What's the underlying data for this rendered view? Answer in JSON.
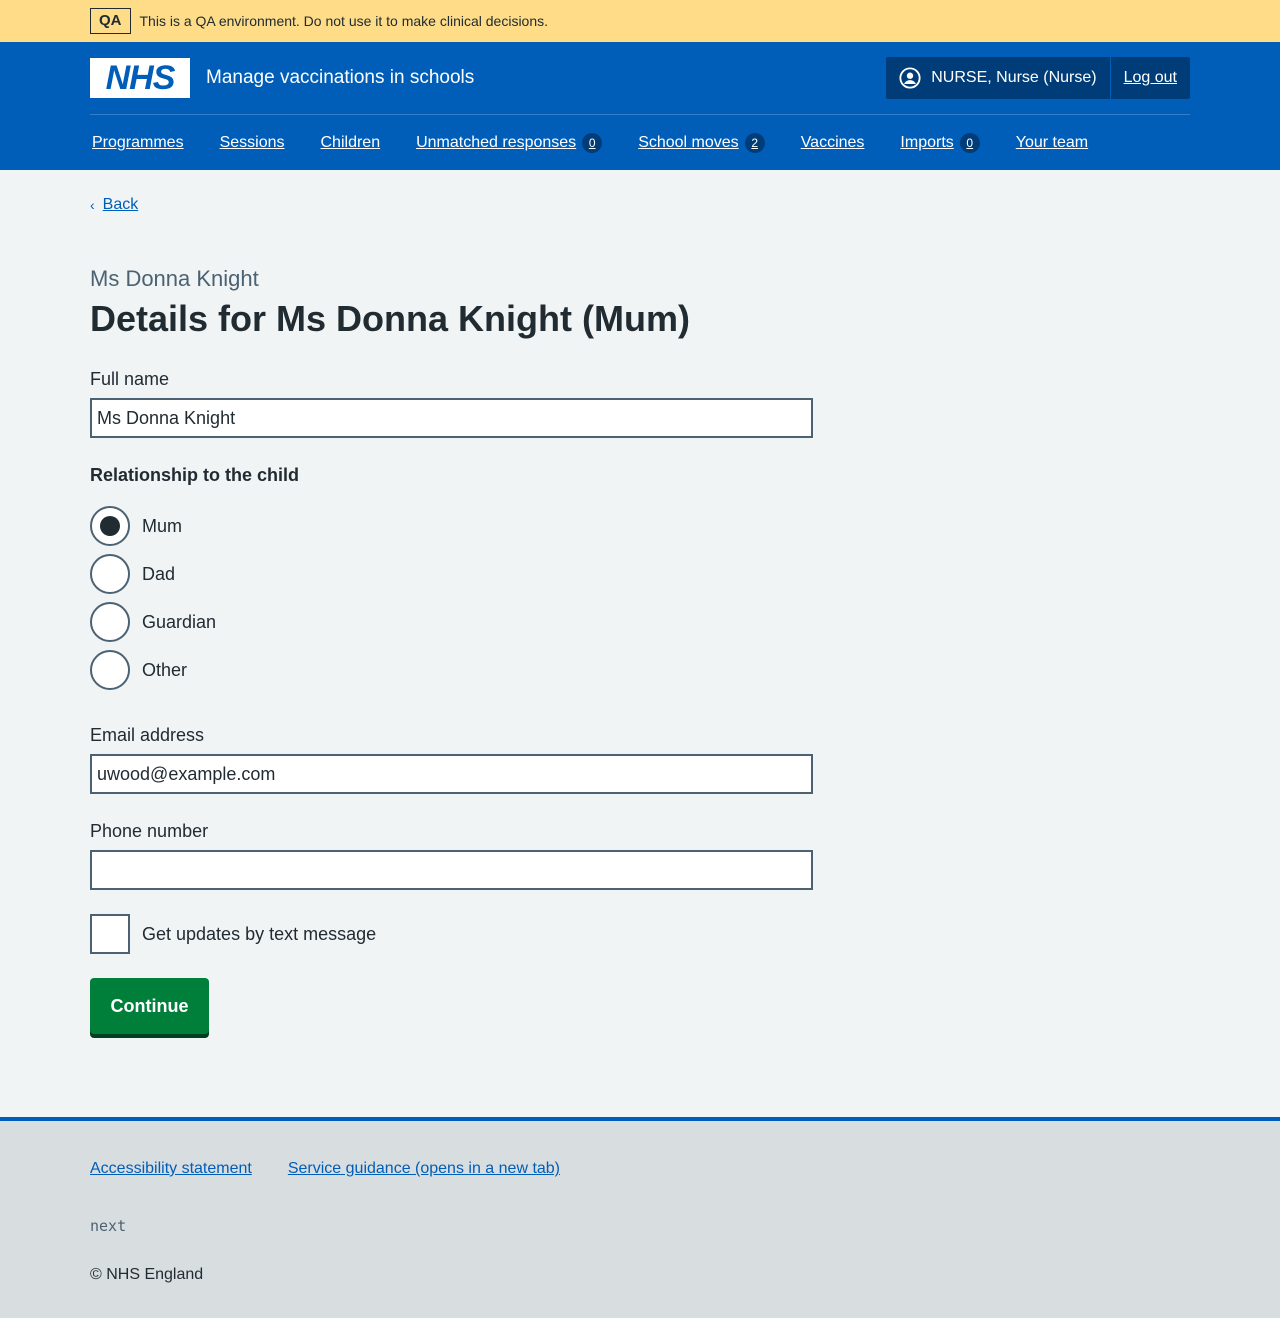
{
  "qa_banner": {
    "tag": "QA",
    "text": "This is a QA environment. Do not use it to make clinical decisions."
  },
  "header": {
    "logo_text": "NHS",
    "service_name": "Manage vaccinations in schools",
    "user": "NURSE, Nurse (Nurse)",
    "logout": "Log out"
  },
  "nav": {
    "items": [
      {
        "label": "Programmes"
      },
      {
        "label": "Sessions"
      },
      {
        "label": "Children"
      },
      {
        "label": "Unmatched responses",
        "count": "0"
      },
      {
        "label": "School moves",
        "count": "2"
      },
      {
        "label": "Vaccines"
      },
      {
        "label": "Imports",
        "count": "0"
      },
      {
        "label": "Your team"
      }
    ]
  },
  "main": {
    "back": "Back",
    "caption": "Ms Donna Knight",
    "title": "Details for Ms Donna Knight (Mum)",
    "full_name_label": "Full name",
    "full_name_value": "Ms Donna Knight",
    "relationship_legend": "Relationship to the child",
    "relationship_options": [
      {
        "label": "Mum",
        "selected": true
      },
      {
        "label": "Dad",
        "selected": false
      },
      {
        "label": "Guardian",
        "selected": false
      },
      {
        "label": "Other",
        "selected": false
      }
    ],
    "email_label": "Email address",
    "email_value": "uwood@example.com",
    "phone_label": "Phone number",
    "phone_value": "",
    "sms_checkbox_label": "Get updates by text message",
    "sms_checked": false,
    "continue_button": "Continue"
  },
  "footer": {
    "links": [
      "Accessibility statement",
      "Service guidance (opens in a new tab)"
    ],
    "version": "next",
    "copyright": "© NHS England"
  },
  "colors": {
    "nhs_blue": "#005eb8",
    "qa_yellow": "#ffdd88",
    "button_green": "#007f3b",
    "page_background": "#f0f4f5",
    "footer_background": "#d8dde0"
  }
}
